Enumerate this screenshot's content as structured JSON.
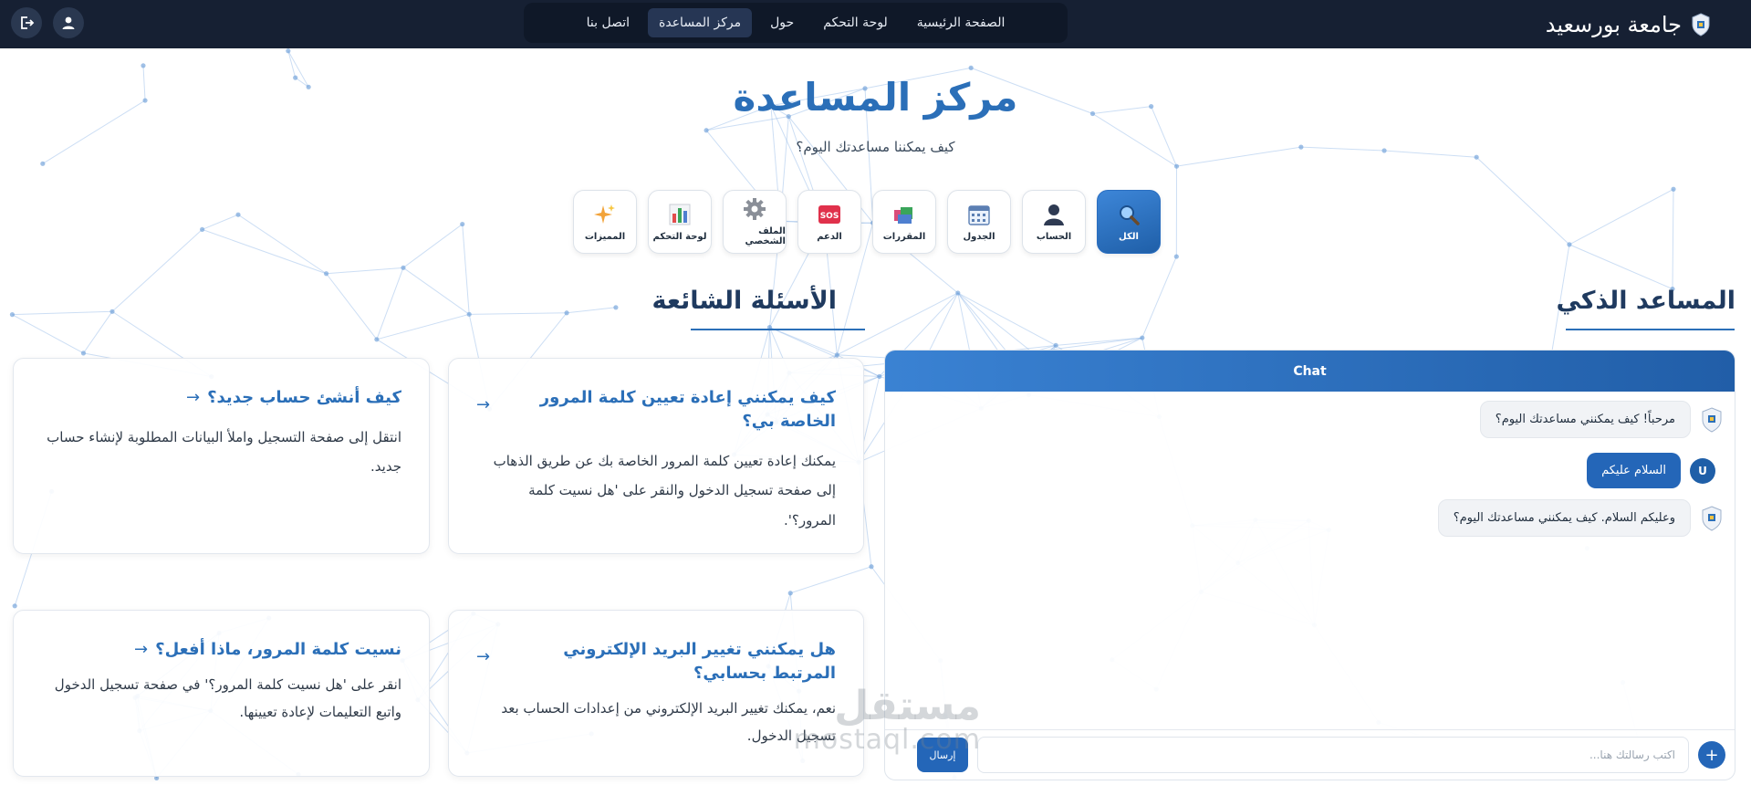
{
  "nav": {
    "brand": "جامعة بورسعيد",
    "links": [
      {
        "label": "الصفحة الرئيسية",
        "active": false
      },
      {
        "label": "لوحة التحكم",
        "active": false
      },
      {
        "label": "حول",
        "active": false
      },
      {
        "label": "مركز المساعدة",
        "active": true
      },
      {
        "label": "اتصل بنا",
        "active": false
      }
    ],
    "icons": [
      "user-icon",
      "logout-icon"
    ]
  },
  "header": {
    "title": "مركز المساعدة",
    "subtitle": "كيف يمكننا مساعدتك اليوم؟"
  },
  "categories": [
    {
      "label": "الكل",
      "icon": "magnifier-icon",
      "active": true
    },
    {
      "label": "الحساب",
      "icon": "person-icon",
      "active": false
    },
    {
      "label": "الجدول",
      "icon": "calendar-icon",
      "active": false
    },
    {
      "label": "المقررات",
      "icon": "books-icon",
      "active": false
    },
    {
      "label": "الدعم",
      "icon": "sos-icon",
      "active": false
    },
    {
      "label": "الملف الشخصي",
      "icon": "gear-icon",
      "active": false
    },
    {
      "label": "لوحة التحكم",
      "icon": "bar-chart-icon",
      "active": false
    },
    {
      "label": "المميزات",
      "icon": "sparkles-icon",
      "active": false
    }
  ],
  "faq": {
    "title": "الأسئلة الشائعة",
    "items": [
      {
        "question": "كيف يمكنني إعادة تعيين كلمة المرور الخاصة بي؟",
        "answer": "يمكنك إعادة تعيين كلمة المرور الخاصة بك عن طريق الذهاب إلى صفحة تسجيل الدخول والنقر على 'هل نسيت كلمة المرور؟'."
      },
      {
        "question": "كيف أنشئ حساب جديد؟",
        "answer": "انتقل إلى صفحة التسجيل واملأ البيانات المطلوبة لإنشاء حساب جديد."
      },
      {
        "question": "هل يمكنني تغيير البريد الإلكتروني المرتبط بحسابي؟",
        "answer": "نعم، يمكنك تغيير البريد الإلكتروني من إعدادات الحساب بعد تسجيل الدخول."
      },
      {
        "question": "نسيت كلمة المرور، ماذا أفعل؟",
        "answer": "انقر على 'هل نسيت كلمة المرور؟' في صفحة تسجيل الدخول واتبع التعليمات لإعادة تعيينها."
      }
    ],
    "arrow": "→"
  },
  "assistant": {
    "title": "المساعد الذكي",
    "chat_header": "Chat",
    "messages": [
      {
        "from": "bot",
        "text": "مرحباً! كيف يمكنني مساعدتك اليوم؟"
      },
      {
        "from": "user",
        "text": "السلام عليكم",
        "avatar": "U"
      },
      {
        "from": "bot",
        "text": "وعليكم السلام. كيف يمكنني مساعدتك اليوم؟"
      }
    ],
    "input_placeholder": "اكتب رسالتك هنا...",
    "send_label": "إرسال",
    "plus_label": "+"
  },
  "watermark": {
    "arabic": "مستقل",
    "latin": "mostaql.com"
  },
  "colors": {
    "navbar": "#162033",
    "accent": "#2b6fb8",
    "chat_header": "#2a70c0"
  }
}
